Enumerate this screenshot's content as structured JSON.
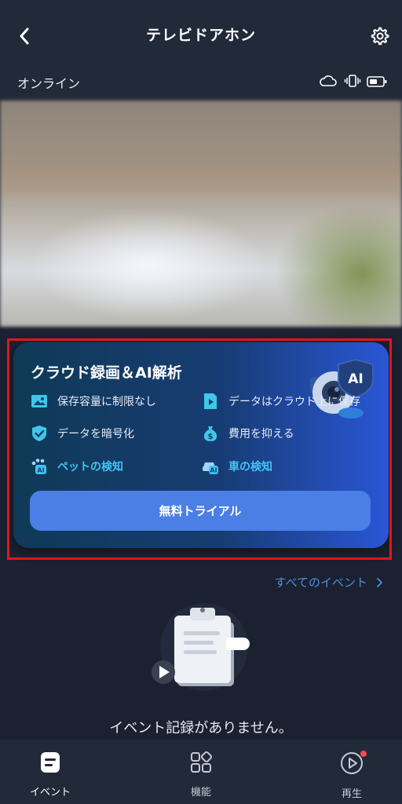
{
  "header": {
    "title": "テレビドアホン"
  },
  "status": {
    "text": "オンライン"
  },
  "promo": {
    "title": "クラウド録画＆AI解析",
    "features": [
      "保存容量に制限なし",
      "データはクラウド上に保存",
      "データを暗号化",
      "費用を抑える",
      "ペットの検知",
      "車の検知"
    ],
    "button": "無料トライアル",
    "badge": "AI"
  },
  "events": {
    "all_link": "すべてのイベント",
    "empty": "イベント記録がありません。"
  },
  "nav": [
    {
      "label": "イベント"
    },
    {
      "label": "機能"
    },
    {
      "label": "再生"
    }
  ],
  "colors": {
    "accent": "#4c7fe6",
    "link": "#4a90e2",
    "highlight": "#e0161b",
    "ai_text": "#41c4f5"
  }
}
